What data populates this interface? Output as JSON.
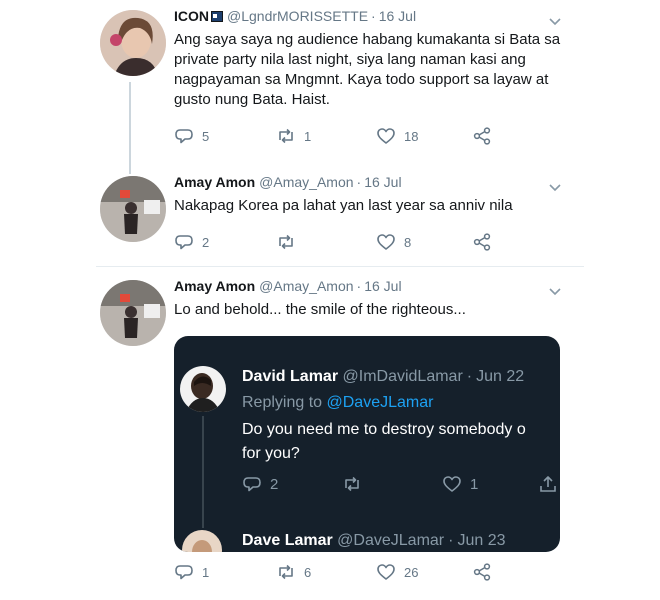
{
  "tweets": [
    {
      "name": "ICON",
      "handle": "@LgndrMORISSETTE",
      "sep": "·",
      "date": "16 Jul",
      "text": "Ang saya saya ng audience habang kumakanta si Bata sa private party nila last night, siya lang naman kasi ang nagpayaman sa Mngmnt. Kaya todo support sa layaw at gusto nung Bata. Haist.",
      "replies": "5",
      "retweets": "1",
      "likes": "18"
    },
    {
      "name": "Amay Amon",
      "handle": "@Amay_Amon",
      "sep": "·",
      "date": "16 Jul",
      "text": "Nakapag Korea pa lahat yan last year sa anniv nila",
      "replies": "2",
      "retweets": "",
      "likes": "8"
    },
    {
      "name": "Amay Amon",
      "handle": "@Amay_Amon",
      "sep": "·",
      "date": "16 Jul",
      "text": "Lo and behold... the smile of the righteous...",
      "replies": "1",
      "retweets": "6",
      "likes": "26"
    }
  ],
  "quoted": {
    "name": "David Lamar",
    "handle": "@ImDavidLamar",
    "sep": "·",
    "date": "Jun 22",
    "replying_prefix": "Replying to",
    "replying_to": "@DaveJLamar",
    "text_line1": "Do you need me to destroy somebody o",
    "text_line2": "for you?",
    "replies": "2",
    "retweets": "",
    "likes": "1",
    "next_name": "Dave Lamar",
    "next_handle": "@DaveJLamar",
    "next_sep": "·",
    "next_date": "Jun 23"
  },
  "icons": {
    "reply": "reply-icon",
    "retweet": "retweet-icon",
    "like": "heart-icon",
    "share": "share-icon",
    "more": "chevron-down-icon",
    "badge": "id-badge-icon"
  },
  "colors": {
    "text": "#14171a",
    "muted": "#657786",
    "link": "#1da1f2",
    "card_bg": "#15202b",
    "card_muted": "#8899a6"
  }
}
